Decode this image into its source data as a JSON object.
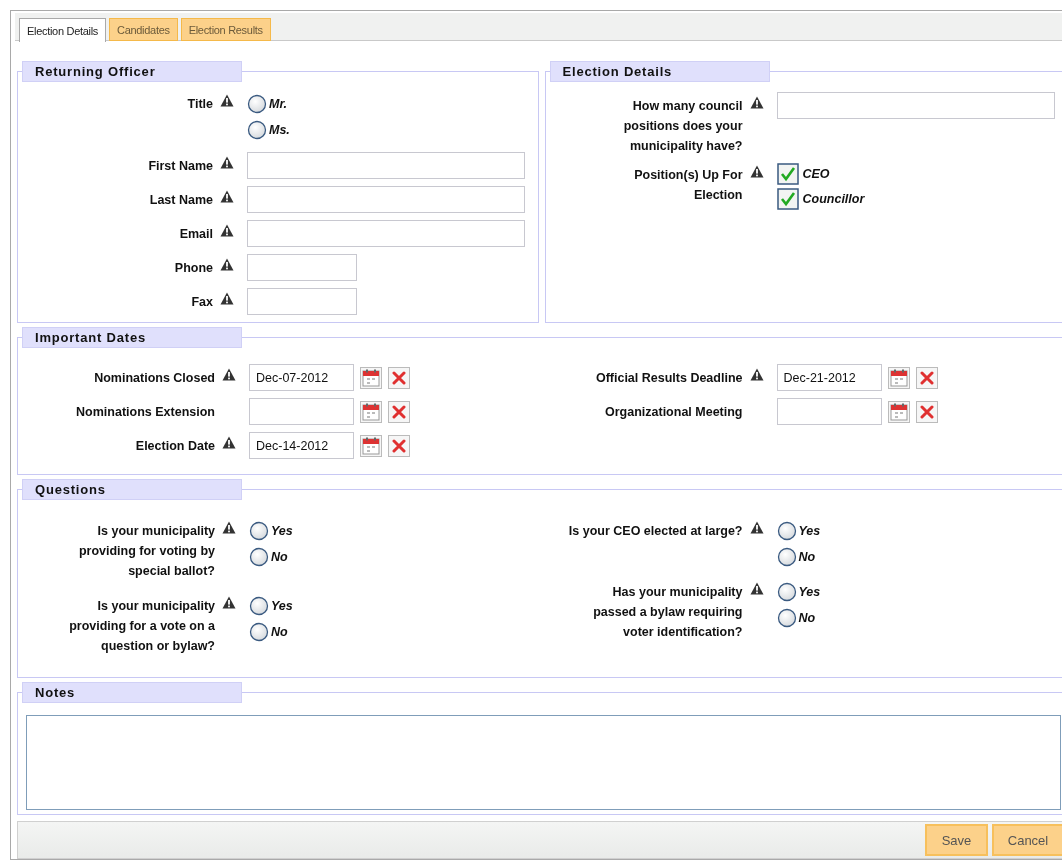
{
  "tabs": [
    {
      "label": "Election Details",
      "selected": true
    },
    {
      "label": "Candidates",
      "selected": false
    },
    {
      "label": "Election Results",
      "selected": false
    }
  ],
  "returning_officer": {
    "title": "Returning Officer",
    "fields": [
      {
        "kind": "radio",
        "label": "Title",
        "required": true,
        "options": [
          {
            "label": "Mr.",
            "selected": false
          },
          {
            "label": "Ms.",
            "selected": false
          }
        ]
      },
      {
        "kind": "wide",
        "label": "First Name",
        "required": true
      },
      {
        "kind": "wide",
        "label": "Last Name",
        "required": true
      },
      {
        "kind": "wide",
        "label": "Email",
        "required": true
      },
      {
        "kind": "narrow",
        "label": "Phone",
        "required": true
      },
      {
        "kind": "narrow",
        "label": "Fax",
        "required": true
      }
    ]
  },
  "election_details": {
    "title": "Election Details",
    "fields": [
      {
        "kind": "wide",
        "label": "How many council positions does your municipality have?",
        "required": true
      },
      {
        "kind": "checkbox",
        "label": "Position(s) Up For Election",
        "required": true,
        "options": [
          {
            "label": "CEO",
            "checked": true
          },
          {
            "label": "Councillor",
            "checked": true
          }
        ]
      }
    ]
  },
  "important_dates": {
    "title": "Important Dates",
    "columns": [
      [
        {
          "label": "Nominations Closed",
          "required": true,
          "value": "Dec-07-2012"
        },
        {
          "label": "Nominations Extension",
          "required": false
        },
        {
          "label": "Election Date",
          "required": true,
          "value": "Dec-14-2012"
        }
      ],
      [
        {
          "label": "Official Results Deadline",
          "required": true,
          "value": "Dec-21-2012"
        },
        {
          "label": "Organizational Meeting",
          "required": false
        }
      ]
    ]
  },
  "questions": {
    "title": "Questions",
    "columns": [
      [
        {
          "label": "Is your municipality providing for voting by special ballot?",
          "required": true,
          "options": [
            {
              "label": "Yes",
              "selected": false
            },
            {
              "label": "No",
              "selected": false
            }
          ]
        },
        {
          "label": "Is your municipality providing for a vote on a question or bylaw?",
          "required": true,
          "options": [
            {
              "label": "Yes",
              "selected": false
            },
            {
              "label": "No",
              "selected": false
            }
          ]
        }
      ],
      [
        {
          "label": "Is your CEO elected at large?",
          "required": true,
          "options": [
            {
              "label": "Yes",
              "selected": false
            },
            {
              "label": "No",
              "selected": false
            }
          ]
        },
        {
          "label": "Has your municipality passed a bylaw requiring voter identification?",
          "required": true,
          "options": [
            {
              "label": "Yes",
              "selected": false
            },
            {
              "label": "No",
              "selected": false
            }
          ]
        }
      ]
    ]
  },
  "notes": {
    "title": "Notes"
  },
  "buttons": [
    "Save",
    "Cancel"
  ]
}
